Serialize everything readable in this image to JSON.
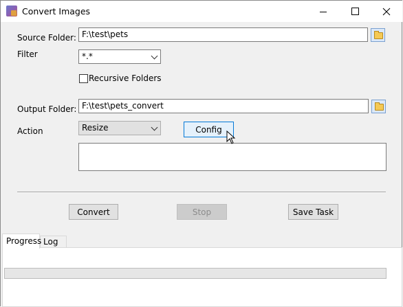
{
  "window": {
    "title": "Convert Images"
  },
  "source": {
    "label": "Source Folder:",
    "value": "F:\\test\\pets"
  },
  "filter": {
    "label": "Filter",
    "value": "*.*"
  },
  "recursive": {
    "label": "Recursive Folders",
    "checked": false
  },
  "output": {
    "label": "Output Folder:",
    "value": "F:\\test\\pets_convert"
  },
  "action": {
    "label": "Action",
    "value": "Resize",
    "config_label": "Config"
  },
  "buttons": {
    "convert": "Convert",
    "stop": "Stop",
    "save_task": "Save Task"
  },
  "tabs": [
    {
      "label": "Progress"
    },
    {
      "label": "Log"
    }
  ],
  "progress": {
    "fraction": 0
  },
  "icons": {
    "folder": "folder-icon",
    "app": "app-icon"
  }
}
